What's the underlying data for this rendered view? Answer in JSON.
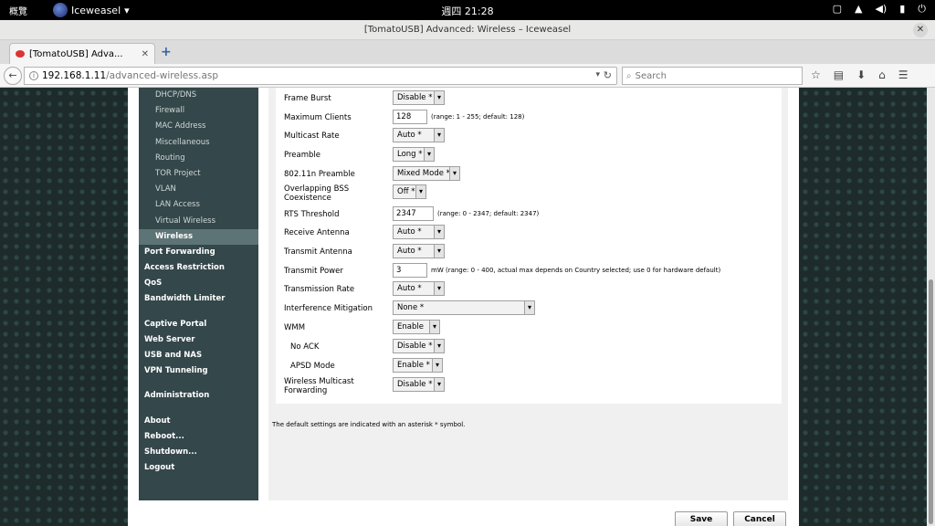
{
  "topbar": {
    "activities": "概覽",
    "app_menu": "Iceweasel",
    "app_menu_arrow": "▾",
    "clock": "週四  21:28",
    "tray_icons": [
      "window-icon",
      "network-icon",
      "volume-icon",
      "battery-icon",
      "power-icon"
    ]
  },
  "window": {
    "title": "[TomatoUSB] Advanced: Wireless – Iceweasel",
    "close": "✕"
  },
  "tab": {
    "title": "[TomatoUSB] Adva...",
    "close": "✕",
    "new_tab": "+"
  },
  "navbar": {
    "back": "←",
    "url_host": "192.168.1.11",
    "url_path": "/advanced-wireless.asp",
    "search_placeholder": "Search"
  },
  "sidebar": {
    "subitems": [
      {
        "label": "DHCP/DNS"
      },
      {
        "label": "Firewall"
      },
      {
        "label": "MAC Address"
      },
      {
        "label": "Miscellaneous"
      },
      {
        "label": "Routing"
      },
      {
        "label": "TOR Project"
      },
      {
        "label": "VLAN"
      },
      {
        "label": "LAN Access"
      },
      {
        "label": "Virtual Wireless"
      },
      {
        "label": "Wireless"
      }
    ],
    "groups": [
      [
        "Port Forwarding",
        "Access Restriction",
        "QoS",
        "Bandwidth Limiter"
      ],
      [
        "Captive Portal",
        "Web Server",
        "USB and NAS",
        "VPN Tunneling"
      ],
      [
        "Administration"
      ],
      [
        "About",
        "Reboot...",
        "Shutdown...",
        "Logout"
      ]
    ]
  },
  "form": {
    "rows": [
      {
        "label": "Frame Burst",
        "type": "select",
        "value": "Disable *"
      },
      {
        "label": "Maximum Clients",
        "type": "text",
        "value": "128",
        "hint": "(range: 1 - 255; default: 128)"
      },
      {
        "label": "Multicast Rate",
        "type": "select",
        "value": "Auto *"
      },
      {
        "label": "Preamble",
        "type": "select",
        "value": "Long *"
      },
      {
        "label": "802.11n Preamble",
        "type": "select",
        "value": "Mixed Mode *"
      },
      {
        "label": "Overlapping BSS Coexistence",
        "type": "select",
        "value": "Off *"
      },
      {
        "label": "RTS Threshold",
        "type": "text",
        "value": "2347",
        "hint": "(range: 0 - 2347; default: 2347)"
      },
      {
        "label": "Receive Antenna",
        "type": "select",
        "value": "Auto *"
      },
      {
        "label": "Transmit Antenna",
        "type": "select",
        "value": "Auto *"
      },
      {
        "label": "Transmit Power",
        "type": "text",
        "value": "3",
        "hint": "mW  (range: 0 - 400, actual max depends on Country selected; use 0 for hardware default)"
      },
      {
        "label": "Transmission Rate",
        "type": "select",
        "value": "Auto *"
      },
      {
        "label": "Interference Mitigation",
        "type": "select",
        "value": "None *"
      },
      {
        "label": "WMM",
        "type": "select",
        "value": "Enable"
      },
      {
        "label": "No ACK",
        "type": "select",
        "value": "Disable *"
      },
      {
        "label": "APSD Mode",
        "type": "select",
        "value": "Enable *"
      },
      {
        "label": "Wireless Multicast Forwarding",
        "type": "select",
        "value": "Disable *"
      }
    ],
    "note": "The default settings are indicated with an asterisk * symbol."
  },
  "buttons": {
    "save": "Save",
    "cancel": "Cancel"
  }
}
